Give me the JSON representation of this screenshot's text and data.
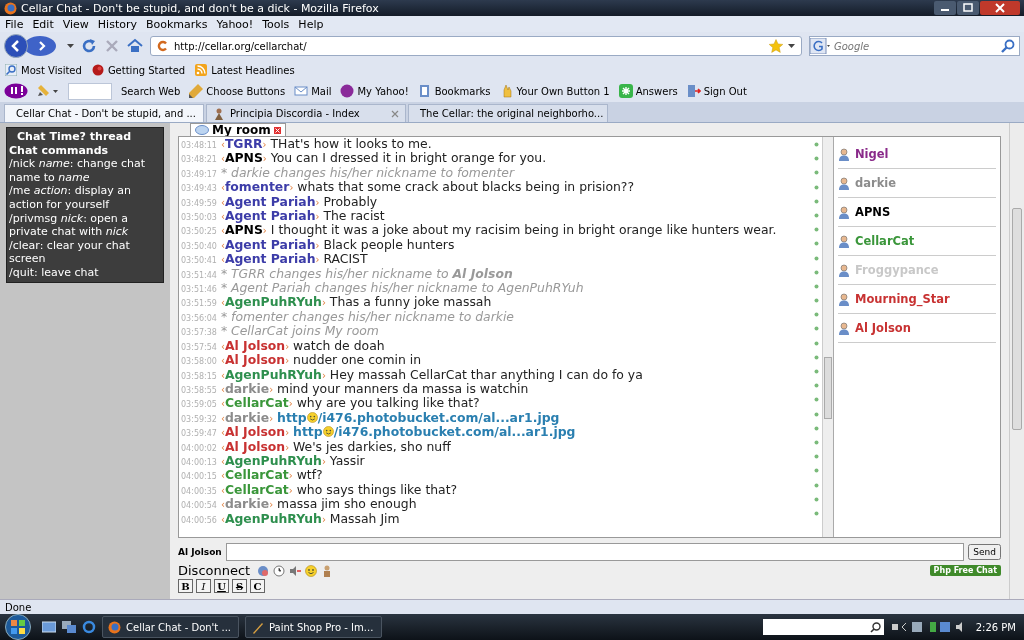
{
  "window": {
    "title": "Cellar Chat - Don't be stupid, and don't be a dick - Mozilla Firefox"
  },
  "menu": [
    "File",
    "Edit",
    "View",
    "History",
    "Bookmarks",
    "Yahoo!",
    "Tools",
    "Help"
  ],
  "address": {
    "value": "http://cellar.org/cellarchat/"
  },
  "search": {
    "placeholder": "Google"
  },
  "bookmarks": [
    "Most Visited",
    "Getting Started",
    "Latest Headlines"
  ],
  "yahoo_toolbar": [
    "Search Web",
    "Choose Buttons",
    "Mail",
    "My Yahoo!",
    "Bookmarks",
    "Your Own Button 1",
    "Answers",
    "Sign Out"
  ],
  "tabs": [
    {
      "label": "Cellar Chat - Don't be stupid, and ...",
      "selected": true
    },
    {
      "label": "Principia Discordia - Index",
      "selected": false
    },
    {
      "label": "The Cellar: the original neighborho...",
      "selected": false
    }
  ],
  "sidebar": {
    "thread_link": "Chat Time? thread",
    "heading": "Chat commands",
    "commands": [
      "/nick *name*: change chat name to *name*",
      "/me *action*: display an action for yourself",
      "/privmsg *nick*: open a private chat with *nick*",
      "/clear: clear your chat screen",
      "/quit: leave chat"
    ]
  },
  "chat": {
    "room": "My room",
    "bracket_open": "‹",
    "bracket_close": "›",
    "messages": [
      {
        "kind": "msg",
        "time": "03:48:11",
        "nick": "TGRR",
        "color": "#3c3ca8",
        "text": "THat's how it looks to me."
      },
      {
        "kind": "msg",
        "time": "03:48:21",
        "nick": "APNS",
        "color": "#000000",
        "text": "You can I dressed it in bright orange for you."
      },
      {
        "kind": "action",
        "time": "03:49:17",
        "text": "* darkie changes his/her nickname to fomenter"
      },
      {
        "kind": "msg",
        "time": "03:49:43",
        "nick": "fomenter",
        "color": "#3c3ca8",
        "text": "whats that some crack about blacks being in prision??"
      },
      {
        "kind": "msg",
        "time": "03:49:59",
        "nick": "Agent Pariah",
        "color": "#3c3ca8",
        "text": "Probably"
      },
      {
        "kind": "msg",
        "time": "03:50:03",
        "nick": "Agent Pariah",
        "color": "#3c3ca8",
        "text": "The racist"
      },
      {
        "kind": "msg",
        "time": "03:50:25",
        "nick": "APNS",
        "color": "#000000",
        "text": "I thought it was a joke about my racisim being in bright orange like hunters wear."
      },
      {
        "kind": "msg",
        "time": "03:50:40",
        "nick": "Agent Pariah",
        "color": "#3c3ca8",
        "text": "Black people hunters"
      },
      {
        "kind": "msg",
        "time": "03:50:41",
        "nick": "Agent Pariah",
        "color": "#3c3ca8",
        "text": "RACIST"
      },
      {
        "kind": "action",
        "time": "03:51:44",
        "text": "* TGRR changes his/her nickname to **Al Jolson**"
      },
      {
        "kind": "action",
        "time": "03:51:46",
        "text": "* Agent Pariah changes his/her nickname to AgenPuhRYuh"
      },
      {
        "kind": "msg",
        "time": "03:51:59",
        "nick": "AgenPuhRYuh",
        "color": "#2e8f4e",
        "text": "Thas a funny joke massah"
      },
      {
        "kind": "action",
        "time": "03:56:04",
        "text": "* fomenter changes his/her nickname to darkie"
      },
      {
        "kind": "action",
        "time": "03:57:38",
        "text": "* CellarCat joins My room"
      },
      {
        "kind": "msg",
        "time": "03:57:54",
        "nick": "Al Jolson",
        "color": "#c83232",
        "text": "watch de doah"
      },
      {
        "kind": "msg",
        "time": "03:58:00",
        "nick": "Al Jolson",
        "color": "#c83232",
        "text": "nudder one comin in"
      },
      {
        "kind": "msg",
        "time": "03:58:15",
        "nick": "AgenPuhRYuh",
        "color": "#2e8f4e",
        "text": "Hey massah CellarCat thar anything I can do fo ya"
      },
      {
        "kind": "msg",
        "time": "03:58:55",
        "nick": "darkie",
        "color": "#8c8c8c",
        "text": "mind your manners da massa is watchin"
      },
      {
        "kind": "msg",
        "time": "03:59:05",
        "nick": "CellarCat",
        "color": "#3a963a",
        "text": "why are you talking like that?"
      },
      {
        "kind": "link",
        "time": "03:59:32",
        "nick": "darkie",
        "color": "#8c8c8c",
        "url_start": "http",
        "url_end": "/i476.photobucket.com/al...ar1.jpg"
      },
      {
        "kind": "link",
        "time": "03:59:47",
        "nick": "Al Jolson",
        "color": "#c83232",
        "url_start": "http",
        "url_end": "/i476.photobucket.com/al...ar1.jpg"
      },
      {
        "kind": "msg",
        "time": "04:00:02",
        "nick": "Al Jolson",
        "color": "#c83232",
        "text": "We's jes darkies, sho nuff"
      },
      {
        "kind": "msg",
        "time": "04:00:13",
        "nick": "AgenPuhRYuh",
        "color": "#2e8f4e",
        "text": "Yassir"
      },
      {
        "kind": "msg",
        "time": "04:00:15",
        "nick": "CellarCat",
        "color": "#3a963a",
        "text": "wtf?"
      },
      {
        "kind": "msg",
        "time": "04:00:35",
        "nick": "CellarCat",
        "color": "#3a963a",
        "text": "who says things like that?"
      },
      {
        "kind": "msg",
        "time": "04:00:54",
        "nick": "darkie",
        "color": "#8c8c8c",
        "text": "massa jim sho enough"
      },
      {
        "kind": "msg",
        "time": "04:00:56",
        "nick": "AgenPuhRYuh",
        "color": "#2e8f4e",
        "text": "Massah Jim"
      }
    ]
  },
  "users": [
    {
      "name": "Nigel",
      "color": "#8a2a8a"
    },
    {
      "name": "darkie",
      "color": "#8c8c8c"
    },
    {
      "name": "APNS",
      "color": "#000000"
    },
    {
      "name": "CellarCat",
      "color": "#3a963a"
    },
    {
      "name": "Froggypance",
      "color": "#c8c8c8"
    },
    {
      "name": "Mourning_Star",
      "color": "#c83232"
    },
    {
      "name": "Al Jolson",
      "color": "#c83232"
    }
  ],
  "input": {
    "label": "Al Jolson",
    "button": "Send"
  },
  "disconnect": "Disconnect",
  "badge": "Php Free Chat",
  "format_buttons": [
    "B",
    "I",
    "U",
    "S",
    "C"
  ],
  "status_bar": "Done",
  "taskbar": {
    "tasks": [
      "Cellar Chat - Don't ...",
      "Paint Shop Pro - Im..."
    ],
    "clock": "2:26 PM"
  }
}
